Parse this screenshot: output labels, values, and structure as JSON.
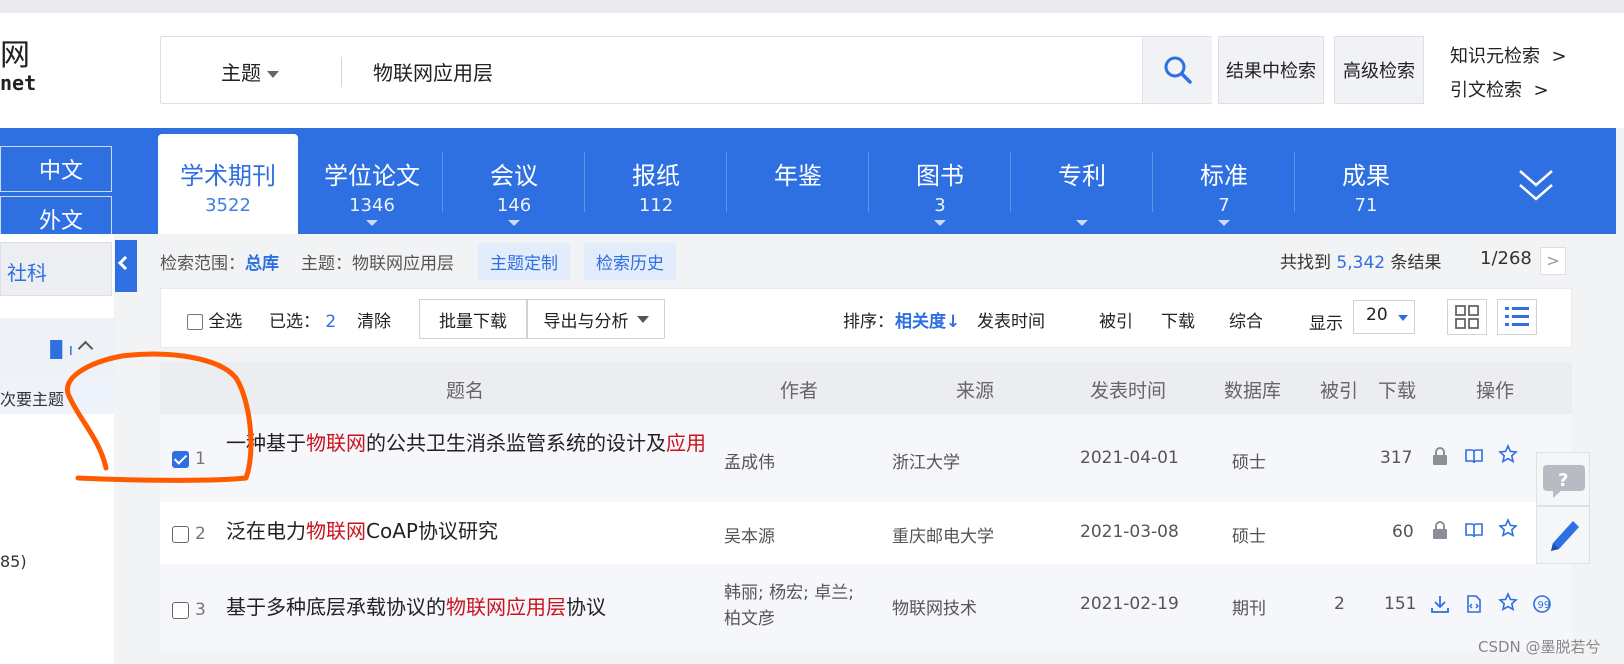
{
  "logo": {
    "line1": "网",
    "line2": "net"
  },
  "search": {
    "field": "主题",
    "query": "物联网应用层"
  },
  "top_buttons": {
    "in_results": "结果中检索",
    "advanced": "高级检索"
  },
  "top_links": {
    "knowledge": "知识元检索",
    "citation": "引文检索",
    "arrow": ">"
  },
  "lang": {
    "cn": "中文",
    "foreign": "外文"
  },
  "tabs": [
    {
      "label": "学术期刊",
      "count": "3522"
    },
    {
      "label": "学位论文",
      "count": "1346"
    },
    {
      "label": "会议",
      "count": "146"
    },
    {
      "label": "报纸",
      "count": "112"
    },
    {
      "label": "年鉴",
      "count": ""
    },
    {
      "label": "图书",
      "count": "3"
    },
    {
      "label": "专利",
      "count": ""
    },
    {
      "label": "标准",
      "count": "7"
    },
    {
      "label": "成果",
      "count": "71"
    }
  ],
  "left_panel": {
    "category": "社科",
    "facet_item": "次要主题",
    "count_text": "85)"
  },
  "scope": {
    "label": "检索范围：",
    "library": "总库",
    "topic": "主题：物联网应用层",
    "custom": "主题定制",
    "history": "检索历史"
  },
  "results": {
    "prefix": "共找到",
    "count": "5,342",
    "suffix": "条结果",
    "page": "1/268",
    "next": ">"
  },
  "toolbar": {
    "select_all": "全选",
    "selected_label": "已选：",
    "selected_count": "2",
    "clear": "清除",
    "batch_download": "批量下载",
    "export": "导出与分析",
    "sort_label": "排序：",
    "sort_relevance": "相关度",
    "sort_arrow": "↓",
    "sort_date": "发表时间",
    "sort_cited": "被引",
    "sort_download": "下载",
    "sort_overall": "综合",
    "show_label": "显示",
    "page_size": "20"
  },
  "table": {
    "headers": {
      "title": "题名",
      "author": "作者",
      "source": "来源",
      "date": "发表时间",
      "db": "数据库",
      "cited": "被引",
      "downloads": "下载",
      "ops": "操作"
    },
    "rows": [
      {
        "n": "1",
        "checked": true,
        "t1": "一种基于",
        "t2": "物联网",
        "t3": "的公共卫生消杀监管系统的设计及",
        "t4": "应用",
        "author": "孟成伟",
        "author2": "",
        "source": "浙江大学",
        "date": "2021-04-01",
        "db": "硕士",
        "cited": "",
        "downloads": "317"
      },
      {
        "n": "2",
        "checked": false,
        "t1": "泛在电力",
        "t2": "物联网",
        "t3": "CoAP协议研究",
        "t4": "",
        "author": "吴本源",
        "author2": "",
        "source": "重庆邮电大学",
        "date": "2021-03-08",
        "db": "硕士",
        "cited": "",
        "downloads": "60"
      },
      {
        "n": "3",
        "checked": false,
        "t1": "基于多种底层承载协议的",
        "t2": "物联网应用层",
        "t3": "协议",
        "t4": "",
        "author": "韩丽; 杨宏; 卓兰;",
        "author2": "柏文彦",
        "source": "物联网技术",
        "date": "2021-02-19",
        "db": "期刊",
        "cited": "2",
        "downloads": "151"
      }
    ]
  },
  "watermark": "CSDN @墨脱若兮",
  "colors": {
    "brand_blue": "#2e6fe1",
    "highlight_red": "#c8141f",
    "annotation_orange": "#ff5a00"
  }
}
